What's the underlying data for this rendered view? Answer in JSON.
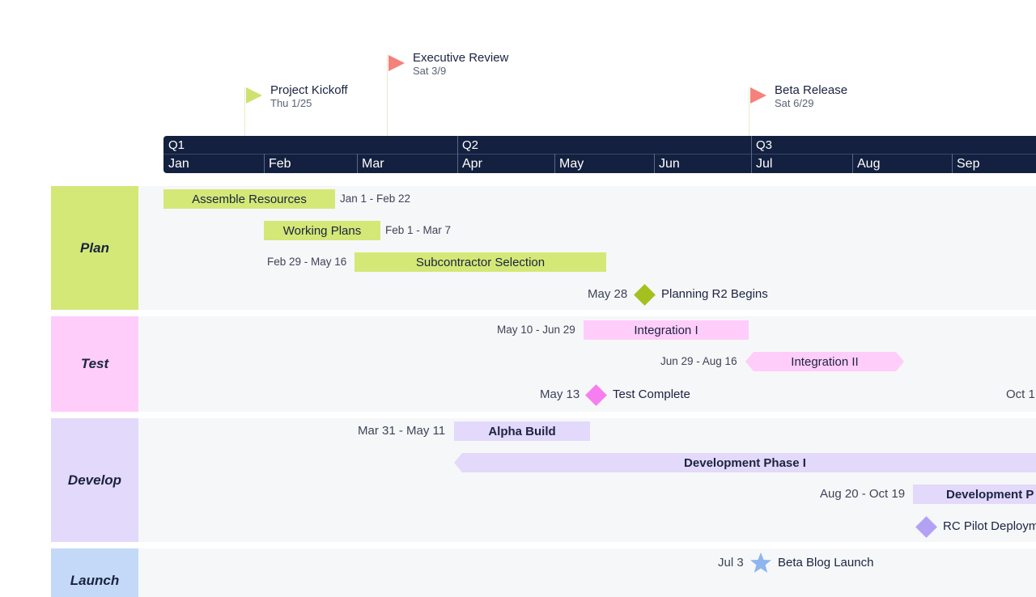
{
  "milestones": [
    {
      "title": "Project Kickoff",
      "date": "Thu 1/25",
      "color": "#cfe070"
    },
    {
      "title": "Executive Review",
      "date": "Sat 3/9",
      "color": "#f4827a"
    },
    {
      "title": "Beta Release",
      "date": "Sat 6/29",
      "color": "#f4827a"
    }
  ],
  "timeline": {
    "quarters": [
      "Q1",
      "Q2",
      "Q3"
    ],
    "months": [
      "Jan",
      "Feb",
      "Mar",
      "Apr",
      "May",
      "Jun",
      "Jul",
      "Aug",
      "Sep"
    ],
    "background": "#13203f"
  },
  "lanes": [
    {
      "name": "Plan",
      "color": "#d4e877"
    },
    {
      "name": "Test",
      "color": "#ffcdfa"
    },
    {
      "name": "Develop",
      "color": "#e3d9fb"
    },
    {
      "name": "Launch",
      "color": "#c3d9f7"
    }
  ],
  "plan": {
    "assemble": {
      "label": "Assemble Resources",
      "dates": "Jan 1 - Feb 22"
    },
    "working": {
      "label": "Working Plans",
      "dates": "Feb 1 - Mar 7"
    },
    "subcontractor": {
      "label": "Subcontractor Selection",
      "dates": "Feb 29 - May 16"
    },
    "r2": {
      "label": "Planning R2 Begins",
      "date": "May 28",
      "color": "#a3c11e"
    }
  },
  "test": {
    "integration1": {
      "label": "Integration I",
      "dates": "May 10 - Jun 29"
    },
    "integration2": {
      "label": "Integration II",
      "dates": "Jun 29 - Aug 16"
    },
    "complete": {
      "label": "Test Complete",
      "date": "May 13",
      "color": "#f77ef0"
    },
    "oct": {
      "date": "Oct 1"
    }
  },
  "develop": {
    "alpha": {
      "label": "Alpha Build",
      "dates": "Mar 31 - May 11"
    },
    "phase1": {
      "label": "Development Phase I"
    },
    "phase2": {
      "label": "Development P",
      "dates": "Aug 20 - Oct 19"
    },
    "rc": {
      "label": "RC Pilot Deploym",
      "color": "#b3a2f4"
    }
  },
  "launch": {
    "blog": {
      "label": "Beta Blog Launch",
      "date": "Jul 3",
      "color": "#8fb5ee"
    }
  }
}
